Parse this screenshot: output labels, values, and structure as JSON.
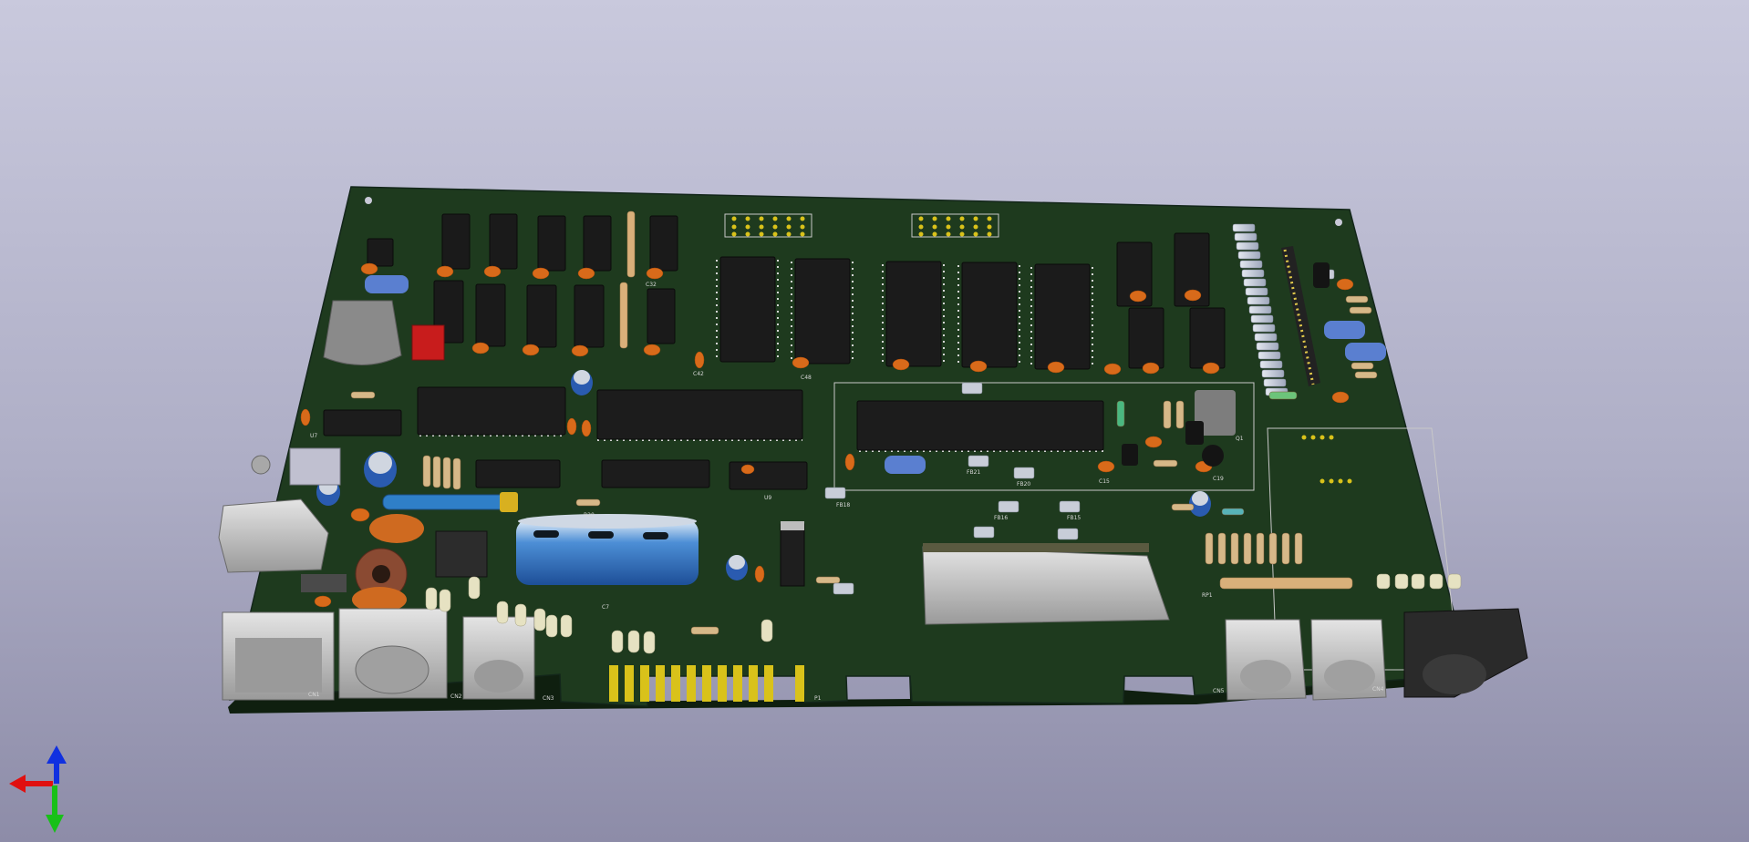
{
  "viewer": {
    "background_top": "#c9c9dd",
    "background_bottom": "#8d8ca8",
    "board_color": "#1e3a1e",
    "silk_color": "#d8d8d8",
    "gold_color": "#d9c21a"
  },
  "silkscreen": {
    "cn1": "CN1",
    "cn2": "CN2",
    "cn3": "CN3",
    "cn4": "CN4",
    "cn5": "CN5",
    "p1": "P1",
    "c7": "C7",
    "c48": "C48",
    "c42": "C42",
    "c32": "C32",
    "c15": "C15",
    "c19": "C19",
    "r20": "R20",
    "fb16": "FB16",
    "fb18": "FB18",
    "fb15": "FB15",
    "fb20": "FB20",
    "fb21": "FB21",
    "rp1": "RP1",
    "u7": "U7",
    "u9": "U9",
    "q1": "Q1"
  },
  "axes_gizmo": {
    "x_color": "#e01010",
    "y_color": "#18c018",
    "z_color": "#1030e0"
  }
}
